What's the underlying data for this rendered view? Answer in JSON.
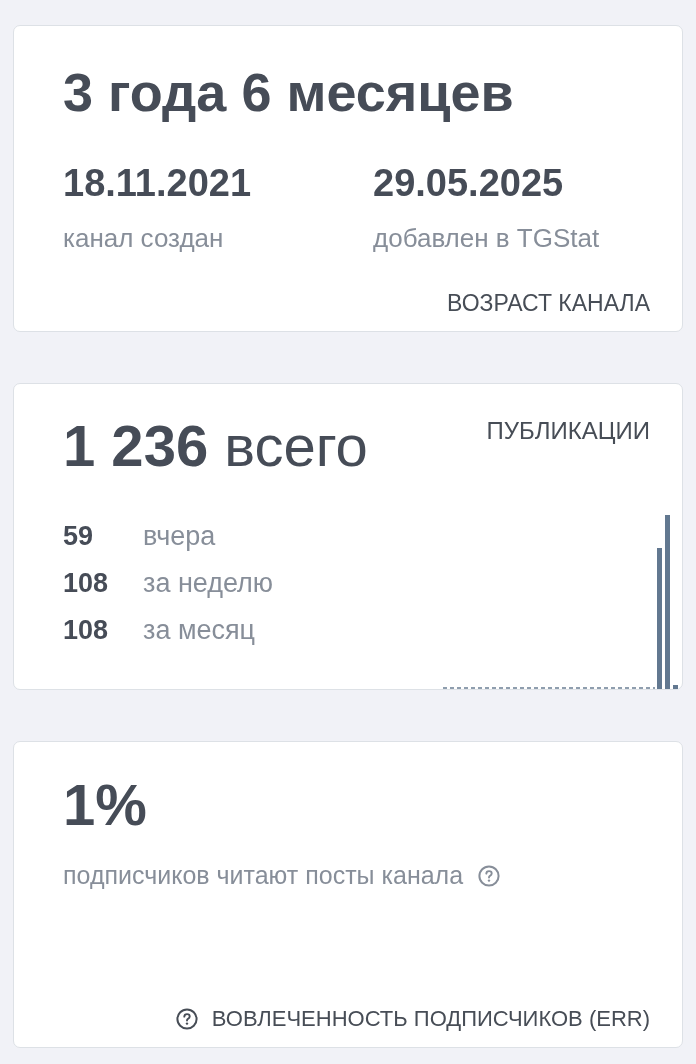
{
  "channel_age": {
    "title": "3 года 6 месяцев",
    "dates": [
      {
        "value": "18.11.2021",
        "label": "канал создан"
      },
      {
        "value": "29.05.2025",
        "label": "добавлен в TGStat"
      }
    ],
    "caption": "ВОЗРАСТ КАНАЛА"
  },
  "publications": {
    "total": "**1 236** всего",
    "caption": "ПУБЛИКАЦИИ",
    "periods": [
      {
        "value": "59",
        "label": "вчера"
      },
      {
        "value": "108",
        "label": "за неделю"
      },
      {
        "value": "108",
        "label": "за месяц"
      }
    ]
  },
  "engagement": {
    "value": "1%",
    "description": "подписчиков читают посты канала",
    "caption": "ВОВЛЕЧЕННОСТЬ ПОДПИСЧИКОВ (ERR)"
  }
}
